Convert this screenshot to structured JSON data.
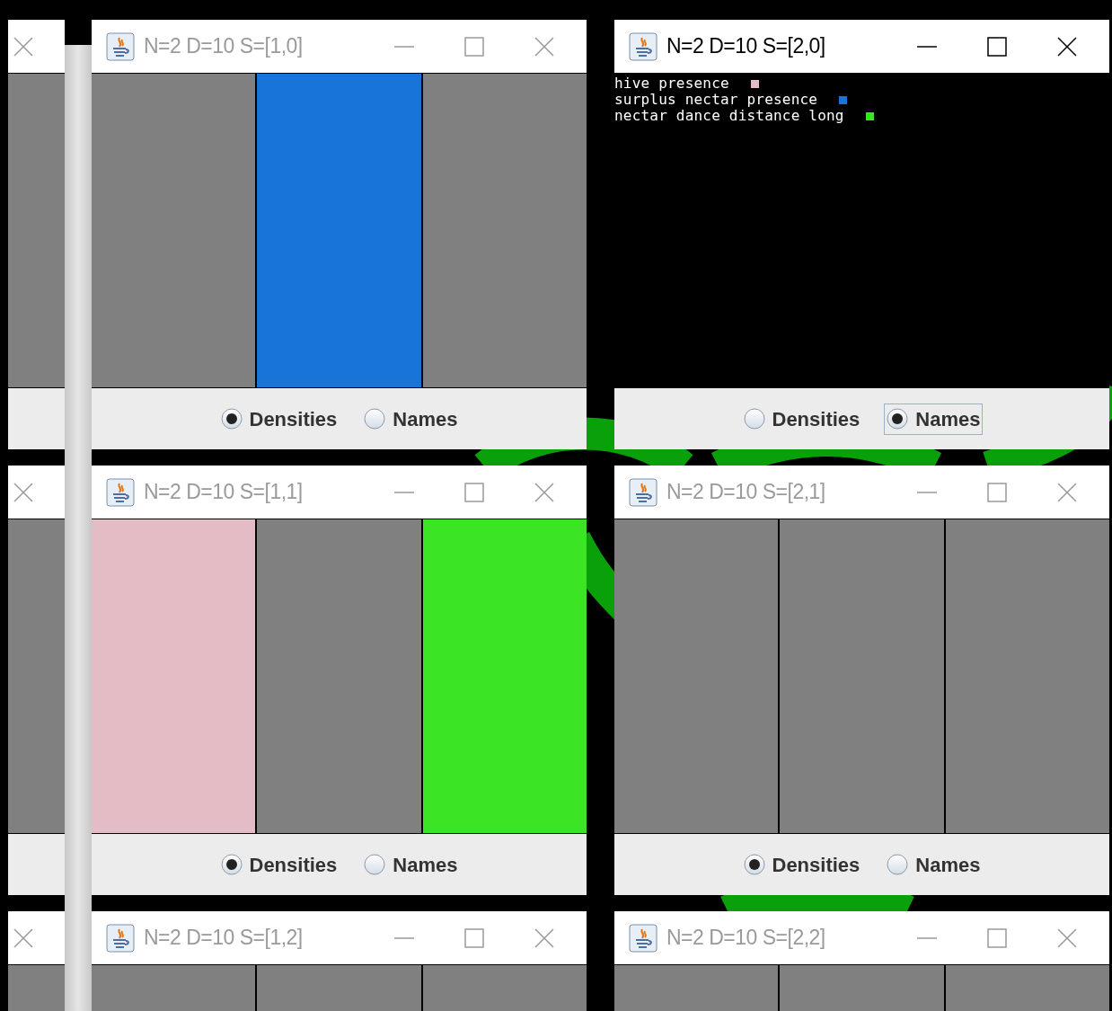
{
  "windows": [
    {
      "title": "N=2 D=10 S=[1,0]",
      "active": false,
      "kind": "cells",
      "cells": [
        {
          "color": "#808080"
        },
        {
          "color": "#1874d8"
        },
        {
          "color": "#808080"
        }
      ],
      "options": [
        {
          "label": "Densities",
          "selected": true,
          "focused": false
        },
        {
          "label": "Names",
          "selected": false,
          "focused": false
        }
      ]
    },
    {
      "title": "N=2 D=10 S=[2,0]",
      "active": true,
      "kind": "legend",
      "legend": [
        {
          "label": "hive presence",
          "color": "#e4bcc6"
        },
        {
          "label": "surplus nectar presence",
          "color": "#1874d8"
        },
        {
          "label": "nectar dance distance long",
          "color": "#3ce523"
        }
      ],
      "options": [
        {
          "label": "Densities",
          "selected": false,
          "focused": false
        },
        {
          "label": "Names",
          "selected": true,
          "focused": true
        }
      ]
    },
    {
      "title": "N=2 D=10 S=[1,1]",
      "active": false,
      "kind": "cells",
      "cells": [
        {
          "color": "#e4bcc6"
        },
        {
          "color": "#808080"
        },
        {
          "color": "#3ce523"
        }
      ],
      "options": [
        {
          "label": "Densities",
          "selected": true,
          "focused": false
        },
        {
          "label": "Names",
          "selected": false,
          "focused": false
        }
      ]
    },
    {
      "title": "N=2 D=10 S=[2,1]",
      "active": false,
      "kind": "cells",
      "cells": [
        {
          "color": "#808080"
        },
        {
          "color": "#808080"
        },
        {
          "color": "#808080"
        }
      ],
      "options": [
        {
          "label": "Densities",
          "selected": true,
          "focused": false
        },
        {
          "label": "Names",
          "selected": false,
          "focused": false
        }
      ]
    },
    {
      "title": "N=2 D=10 S=[1,2]",
      "active": false,
      "kind": "cells",
      "cells": [
        {
          "color": "#808080"
        },
        {
          "color": "#808080"
        },
        {
          "color": "#808080"
        }
      ]
    },
    {
      "title": "N=2 D=10 S=[2,2]",
      "active": false,
      "kind": "cells",
      "cells": [
        {
          "color": "#808080"
        },
        {
          "color": "#808080"
        },
        {
          "color": "#808080"
        }
      ]
    }
  ]
}
